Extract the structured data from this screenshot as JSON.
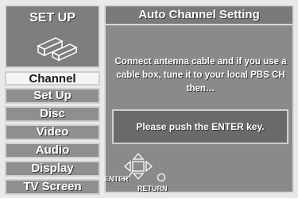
{
  "setup": {
    "title": "SET UP",
    "icon": "setup-devices-icon"
  },
  "menu": {
    "items": [
      {
        "label": "Channel",
        "selected": true
      },
      {
        "label": "Set Up",
        "selected": false
      },
      {
        "label": "Disc",
        "selected": false
      },
      {
        "label": "Video",
        "selected": false
      },
      {
        "label": "Audio",
        "selected": false
      },
      {
        "label": "Display",
        "selected": false
      },
      {
        "label": "TV Screen",
        "selected": false
      }
    ]
  },
  "main": {
    "title": "Auto Channel Setting",
    "instruction_lines": [
      "Connect antenna cable and if you use a",
      "cable box, tune it to your local PBS CH",
      "then…"
    ],
    "prompt": "Please push the ENTER key."
  },
  "nav": {
    "enter_label": "ENTER",
    "return_label": "RETURN"
  },
  "colors": {
    "panel": "#8a8a8a",
    "selected_item": "#f4f4f4",
    "text": "#ffffff"
  }
}
